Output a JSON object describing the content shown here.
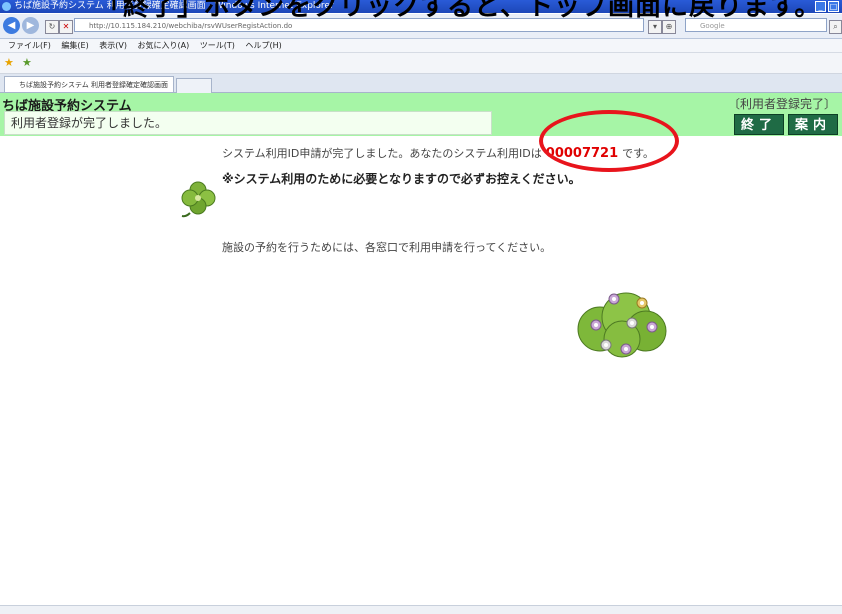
{
  "heading_overlay": "「終了」ボタンをクリックすると、トップ画面に戻ります。",
  "browser": {
    "window_title": "ちば施設予約システム 利用者登録確定確認画面 - Windows Internet Explorer",
    "url": "http://10.115.184.210/webchiba/rsvWUserRegistAction.do",
    "search_placeholder": "Google",
    "menu": [
      "ファイル(F)",
      "編集(E)",
      "表示(V)",
      "お気に入り(A)",
      "ツール(T)",
      "ヘルプ(H)"
    ],
    "tab_title": "ちば施設予約システム 利用者登録確定確認画面"
  },
  "app": {
    "system_title": "ちば施設予約システム",
    "page_label": "〔利用者登録完了〕",
    "status_message": "利用者登録が完了しました。",
    "buttons": {
      "exit": "終了",
      "guide": "案内"
    }
  },
  "content": {
    "line1_before": "システム利用ID申請が完了しました。あなたのシステム利用IDは",
    "user_id": "00007721",
    "line1_after": "です。",
    "line2": "※システム利用のために必要となりますので必ずお控えください。",
    "line3": "施設の予約を行うためには、各窓口で利用申請を行ってください。"
  },
  "colors": {
    "header_green": "#a6f5a6",
    "button_green": "#1f6b45",
    "id_red": "#e00000",
    "annotation_red": "#e8141c"
  }
}
